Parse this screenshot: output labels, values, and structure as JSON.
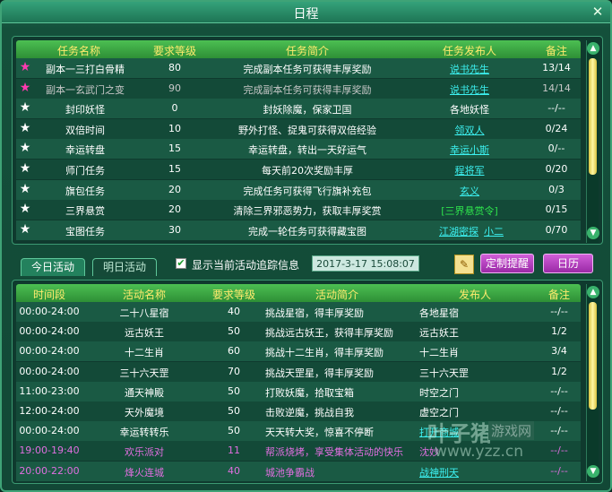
{
  "window": {
    "title": "日程"
  },
  "task_table": {
    "headers": [
      "任务名称",
      "要求等级",
      "任务简介",
      "任务发布人",
      "备注"
    ],
    "rows": [
      {
        "star": "pink",
        "name": "副本一三打白骨精",
        "level": "80",
        "desc": "完成副本任务可获得丰厚奖励",
        "publisher": "说书先生",
        "note": "13/14",
        "dim": false
      },
      {
        "star": "pink",
        "name": "副本一玄武门之变",
        "level": "90",
        "desc": "完成副本任务可获得丰厚奖励",
        "publisher": "说书先生",
        "note": "14/14",
        "dim": true
      },
      {
        "star": "white",
        "name": "封印妖怪",
        "level": "0",
        "desc": "封妖除魔，保家卫国",
        "publisher": "各地妖怪",
        "note": "--/--",
        "dim": false
      },
      {
        "star": "white",
        "name": "双倍时间",
        "level": "10",
        "desc": "野外打怪、捉鬼可获得双倍经验",
        "publisher": "领双人",
        "note": "0/24",
        "dim": false
      },
      {
        "star": "white",
        "name": "幸运转盘",
        "level": "15",
        "desc": "幸运转盘，转出一天好运气",
        "publisher": "幸运小斯",
        "note": "0/--",
        "dim": false
      },
      {
        "star": "white",
        "name": "师门任务",
        "level": "15",
        "desc": "每天前20次奖励丰厚",
        "publisher": "程将军",
        "note": "0/20",
        "dim": false
      },
      {
        "star": "white",
        "name": "旗包任务",
        "level": "20",
        "desc": "完成任务可获得飞行旗补充包",
        "publisher": "玄义",
        "note": "0/3",
        "dim": false
      },
      {
        "star": "white",
        "name": "三界悬赏",
        "level": "20",
        "desc": "清除三界邪恶势力，获取丰厚奖赏",
        "publisher": "[三界悬赏令]",
        "note": "0/15",
        "dim": false
      },
      {
        "star": "white",
        "name": "宝图任务",
        "level": "30",
        "desc": "完成一轮任务可获得藏宝图",
        "publisher": "江湖密探",
        "publisher2": "小二",
        "note": "0/70",
        "dim": false
      }
    ]
  },
  "tabs": {
    "today": "今日活动",
    "tomorrow": "明日活动"
  },
  "show_tracking": {
    "checked": true,
    "label": "显示当前活动追踪信息"
  },
  "datetime": "2017-3-17 15:08:07",
  "buttons": {
    "custom_reminder": "定制提醒",
    "calendar": "日历"
  },
  "activity_table": {
    "headers": [
      "时间段",
      "活动名称",
      "要求等级",
      "活动简介",
      "发布人",
      "备注"
    ],
    "rows": [
      {
        "time": "00:00-24:00",
        "name": "二十八星宿",
        "level": "40",
        "desc": "挑战星宿，得丰厚奖励",
        "publisher": "各地星宿",
        "note": "--/--",
        "style": "normal"
      },
      {
        "time": "00:00-24:00",
        "name": "远古妖王",
        "level": "50",
        "desc": "挑战远古妖王，获得丰厚奖励",
        "publisher": "远古妖王",
        "note": "1/2",
        "style": "normal"
      },
      {
        "time": "00:00-24:00",
        "name": "十二生肖",
        "level": "60",
        "desc": "挑战十二生肖，得丰厚奖励",
        "publisher": "十二生肖",
        "note": "3/4",
        "style": "normal"
      },
      {
        "time": "00:00-24:00",
        "name": "三十六天罡",
        "level": "70",
        "desc": "挑战天罡星，得丰厚奖励",
        "publisher": "三十六天罡",
        "note": "1/2",
        "style": "normal"
      },
      {
        "time": "11:00-23:00",
        "name": "通天神殿",
        "level": "50",
        "desc": "打败妖魔，拾取宝箱",
        "publisher": "时空之门",
        "note": "--/--",
        "style": "normal"
      },
      {
        "time": "12:00-24:00",
        "name": "天外魔境",
        "level": "50",
        "desc": "击败逆魔，挑战自我",
        "publisher": "虚空之门",
        "note": "--/--",
        "style": "normal"
      },
      {
        "time": "00:00-24:00",
        "name": "幸运转转乐",
        "level": "50",
        "desc": "天天转大奖，惊喜不停断",
        "publisher": "打开商城",
        "note": "--/--",
        "style": "link"
      },
      {
        "time": "19:00-19:40",
        "name": "欢乐派对",
        "level": "11",
        "desc": "帮派烧烤，享受集体活动的快乐",
        "publisher": "沈妙",
        "note": "--/--",
        "style": "pink"
      },
      {
        "time": "20:00-22:00",
        "name": "烽火连城",
        "level": "40",
        "desc": "城池争霸战",
        "publisher": "战神刑天",
        "note": "--/--",
        "style": "pink"
      }
    ]
  },
  "watermark": {
    "brand": "叶子猪",
    "site": "游戏网",
    "url": "www.yzz.cn"
  }
}
